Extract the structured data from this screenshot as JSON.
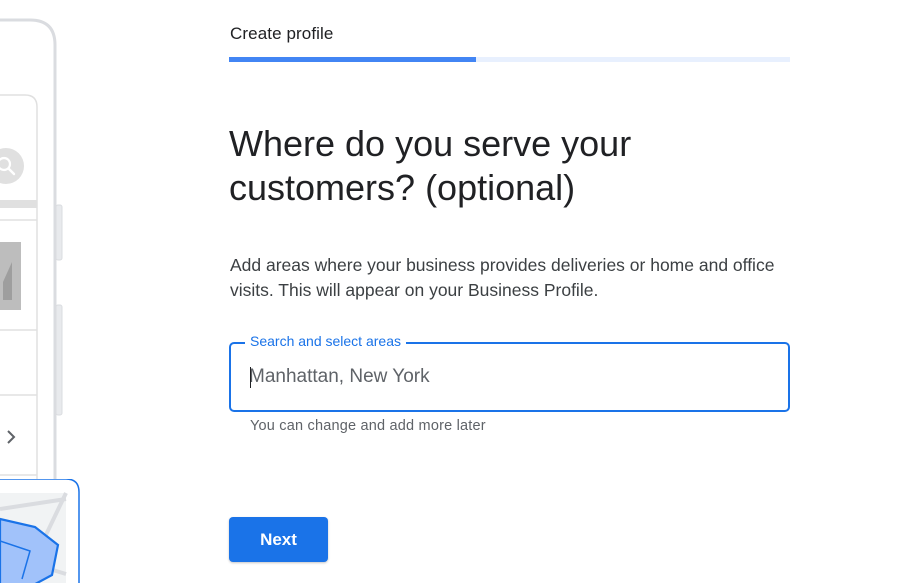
{
  "header": {
    "title": "Create profile",
    "progress_fraction": 0.44
  },
  "main": {
    "question": "Where do you serve your customers? (optional)",
    "description": "Add areas where your business provides deliveries or home and office visits. This will appear on your Business Profile.",
    "search": {
      "label": "Search and select areas",
      "placeholder": "Manhattan, New York",
      "value": ""
    },
    "helper_text": "You can change and add more later",
    "next_label": "Next"
  },
  "colors": {
    "accent": "#1a73e8",
    "progress_fill": "#4285f4",
    "progress_track": "#e8f0fe"
  },
  "icons": [
    "search-icon",
    "chevron-right-icon",
    "map-illustration"
  ]
}
